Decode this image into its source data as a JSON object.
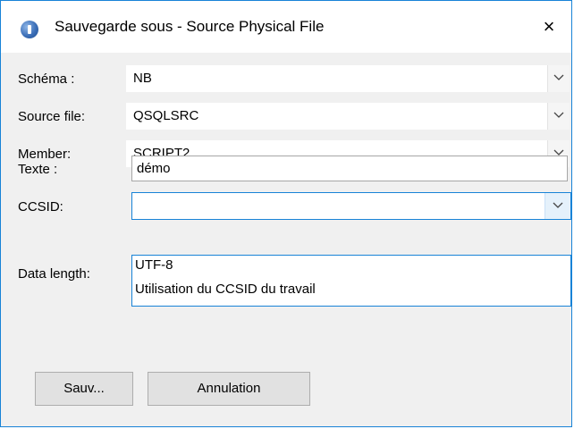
{
  "window": {
    "title": "Sauvegarde sous - Source Physical File"
  },
  "fields": {
    "schema": {
      "label": "Schéma :",
      "value": "NB"
    },
    "source_file": {
      "label": "Source file:",
      "value": "QSQLSRC"
    },
    "member": {
      "label": "Member:",
      "value": "SCRIPT2"
    },
    "texte": {
      "label": "Texte :",
      "value": "démo"
    },
    "ccsid": {
      "label": "CCSID:",
      "value": "",
      "options": [
        "UTF-8",
        "Utilisation du CCSID du travail"
      ]
    },
    "data_length": {
      "label": "Data length:"
    }
  },
  "buttons": {
    "save": "Sauv...",
    "cancel": "Annulation"
  },
  "icons": {
    "close": "×"
  },
  "colors": {
    "accent": "#1883d7"
  }
}
